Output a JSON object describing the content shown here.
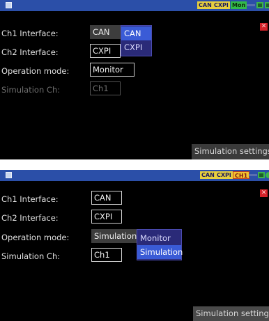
{
  "screen1": {
    "status": {
      "can": "CAN",
      "cxpi": "CXPI",
      "mode": "Mon"
    },
    "close": "✕",
    "labels": {
      "ch1": "Ch1 Interface:",
      "ch2": "Ch2 Interface:",
      "op": "Operation mode:",
      "sim": "Simulation Ch:"
    },
    "values": {
      "ch1": "CAN",
      "ch2": "CXPI",
      "op": "Monitor",
      "sim": "Ch1"
    },
    "dropdown": {
      "options": [
        "CAN",
        "CXPI"
      ],
      "selected": "CAN"
    },
    "sim_settings": "Simulation settings"
  },
  "screen2": {
    "status": {
      "can": "CAN",
      "cxpi": "CXPI",
      "mode": "CH1"
    },
    "close": "✕",
    "labels": {
      "ch1": "Ch1 Interface:",
      "ch2": "Ch2 Interface:",
      "op": "Operation mode:",
      "sim": "Simulation Ch:"
    },
    "values": {
      "ch1": "CAN",
      "ch2": "CXPI",
      "op": "Simulation",
      "sim": "Ch1"
    },
    "dropdown": {
      "options": [
        "Monitor",
        "Simulation"
      ],
      "selected": "Simulation"
    },
    "sim_settings": "Simulation settings"
  }
}
